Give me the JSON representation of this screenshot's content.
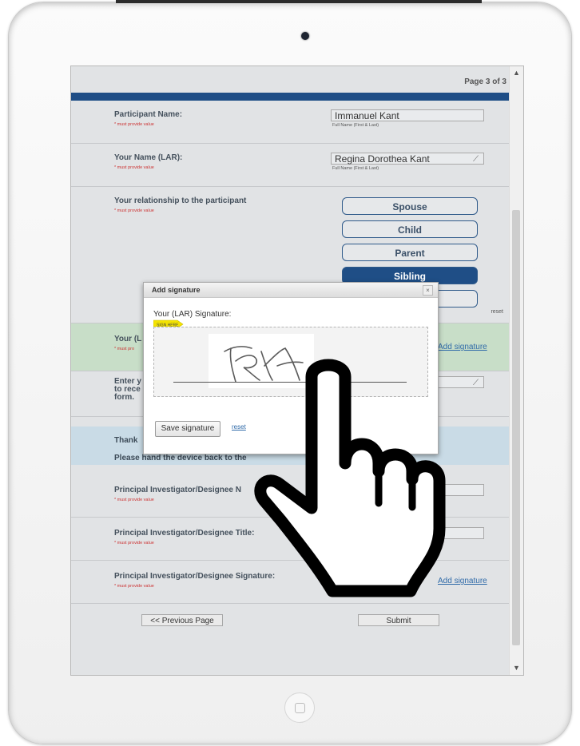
{
  "page_indicator": "Page 3 of 3",
  "fields": {
    "participant": {
      "label": "Participant Name:",
      "required": "* must provide value",
      "value": "Immanuel Kant",
      "hint": "Full Name (First & Last)"
    },
    "lar_name": {
      "label": "Your Name (LAR):",
      "required": "* must provide value",
      "value": "Regina Dorothea Kant",
      "hint": "Full Name (First & Last)"
    },
    "relationship": {
      "label": "Your relationship to the participant",
      "required": "* must provide value",
      "options": [
        "Spouse",
        "Child",
        "Parent",
        "Sibling",
        ""
      ],
      "selected": "Sibling",
      "reset": "reset"
    },
    "lar_signature": {
      "label": "Your (L",
      "required": "* must pro",
      "add": "Add signature"
    },
    "email": {
      "label_line1": "Enter y",
      "label_line2": "to rece",
      "label_line3": "form."
    },
    "thanks": {
      "line1": "Thank",
      "line2": "Please hand the device back to the"
    },
    "pi_name": {
      "label": "Principal Investigator/Designee N",
      "required": "* must provide value"
    },
    "pi_title": {
      "label": "Principal Investigator/Designee Title:",
      "required": "* must provide value"
    },
    "pi_signature": {
      "label": "Principal Investigator/Designee Signature:",
      "required": "* must provide value",
      "add": "Add signature"
    }
  },
  "nav": {
    "prev": "<< Previous Page",
    "submit": "Submit"
  },
  "modal": {
    "title": "Add signature",
    "close": "×",
    "sig_label": "Your (LAR) Signature:",
    "sign_here": "SIGN HERE",
    "save": "Save signature",
    "reset": "reset"
  },
  "colors": {
    "accent": "#1f4e86",
    "link": "#2f6aa8",
    "sig_row": "#c8dec8",
    "info_band": "#c9dbe6"
  }
}
